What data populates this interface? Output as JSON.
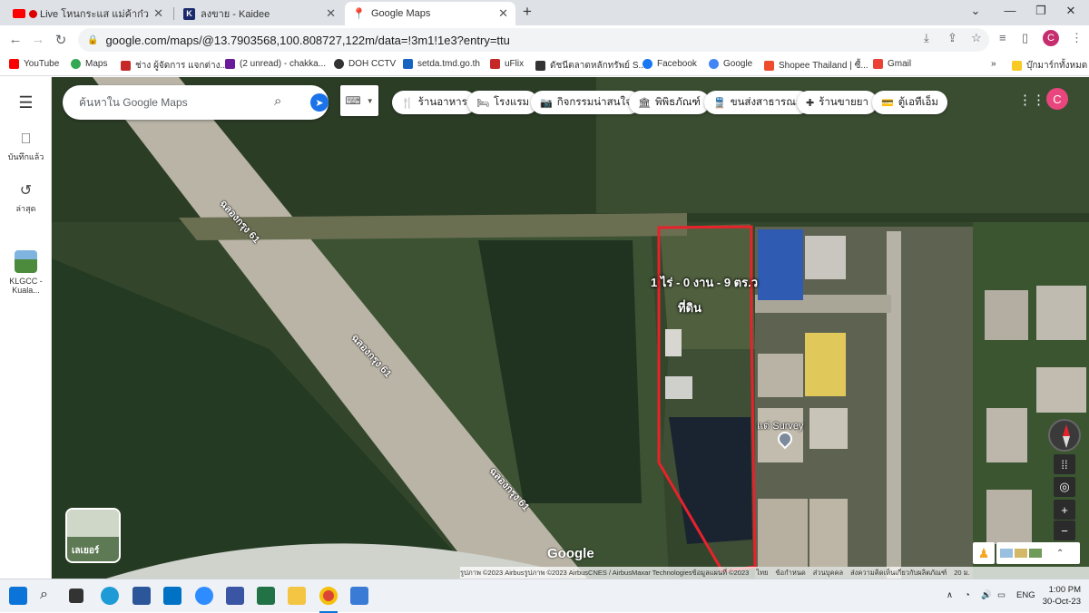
{
  "browser": {
    "tabs": [
      {
        "title": "Live โหนกระแส แม่ค้าก๋วยเตี๋ยว...",
        "active": false
      },
      {
        "title": "ลงขาย - Kaidee",
        "active": false
      },
      {
        "title": "Google Maps",
        "active": true
      }
    ],
    "new_tab": "+",
    "url": "google.com/maps/@13.7903568,100.808727,122m/data=!3m1!1e3?entry=ttu",
    "profile_initial": "C",
    "bookmarks": [
      "YouTube",
      "Maps",
      "ช่าง ผู้จัดการ แจกต่าง...",
      "(2 unread) - chakka...",
      "DOH CCTV",
      "setda.tmd.go.th",
      "uFlix",
      "ดัชนีตลาดหลักทรัพย์ S...",
      "Facebook",
      "Google",
      "Shopee Thailand | ซื้...",
      "Gmail"
    ],
    "bookmarks_more": "»",
    "all_bookmarks": "บุ๊กมาร์กทั้งหมด"
  },
  "maps": {
    "sidebar": [
      {
        "label": "บันทึกแล้ว",
        "icon": "bookmark-icon"
      },
      {
        "label": "ล่าสุด",
        "icon": "history-icon"
      },
      {
        "label": "KLGCC - Kuala...",
        "icon": "place-thumbnail"
      }
    ],
    "search_placeholder": "ค้นหาใน Google Maps",
    "chips": [
      "ร้านอาหาร",
      "โรงแรม",
      "กิจกรรมน่าสนใจ",
      "พิพิธภัณฑ์",
      "ขนส่งสาธารณะ",
      "ร้านขายยา",
      "ตู้เอทีเอ็ม"
    ],
    "road_label": "ฉลองกรุง 61",
    "plot_area": "1 ไร่ - 0 งาน - 9 ตร.ว",
    "plot_type": "ที่ดิน",
    "place_label": "แต่ Survey",
    "layers_label": "เลเยอร์",
    "logo": "Google",
    "attribution": "รูปภาพ ©2023 Airbusรูปภาพ ©2023 AirbusCNES / AirbusMaxar Technologiesข้อมูลแผนที่ ©2023",
    "footer_links": [
      "ไทย",
      "ข้อกำหนด",
      "ส่วนบุคคล",
      "ส่งความคิดเห็นเกี่ยวกับผลิตภัณฑ์"
    ],
    "scale": "20 ม."
  },
  "taskbar": {
    "lang": "ENG",
    "time": "1:00 PM",
    "date": "30-Oct-23"
  },
  "colors": {
    "plot_outline": "#e8222b",
    "accent": "#1a73e8"
  }
}
